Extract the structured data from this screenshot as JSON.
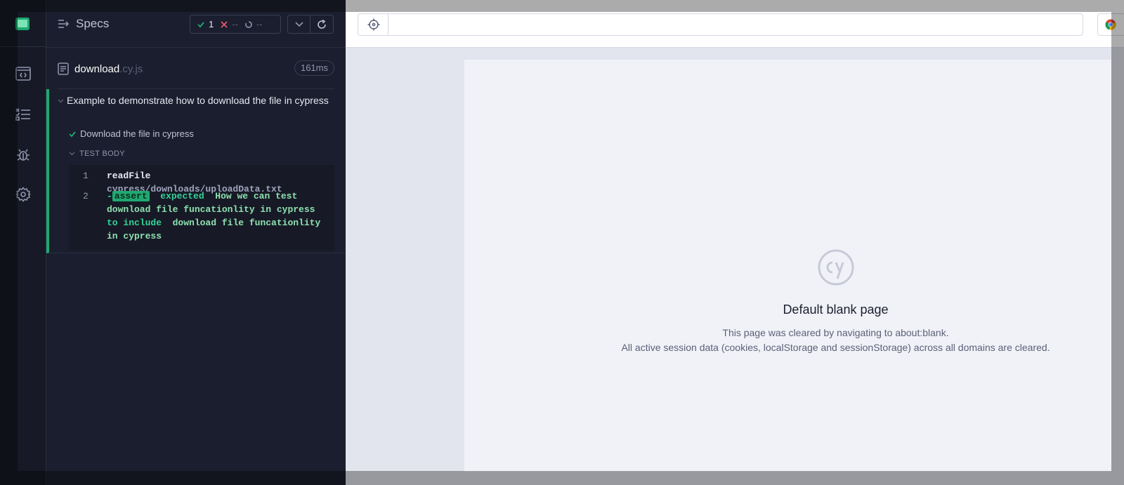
{
  "reporter": {
    "specs_label": "Specs",
    "stats": {
      "passed": "1",
      "failed": "--",
      "pending": "--"
    },
    "spec_file": {
      "name": "download",
      "ext": ".cy.js",
      "duration": "161ms"
    },
    "suite_title": "Example to demonstrate how to download the file in cypress",
    "test_title": "Download the file in cypress",
    "test_body_label": "TEST BODY",
    "commands": [
      {
        "num": "1",
        "name": "readFile",
        "arg": "cypress/downloads/uploadData.txt"
      },
      {
        "num": "2",
        "prefix": "-",
        "badge": "assert",
        "w1": "expected",
        "w2": "How we can test download file funcationlity in cypress",
        "w3": "to include",
        "w4": "download file funcationlity in cypress"
      }
    ]
  },
  "aut": {
    "url": "",
    "blank_title": "Default blank page",
    "blank_msg1": "This page was cleared by navigating to about:blank.",
    "blank_msg2": "All active session data (cookies, localStorage and sessionStorage) across all domains are cleared."
  },
  "icons": [
    "cypress-app-logo-icon",
    "specs-list-icon",
    "runs-icon",
    "debug-icon",
    "settings-icon",
    "selector-playground-icon",
    "chrome-icon",
    "cypress-cy-logo-icon"
  ],
  "colors": {
    "pass": "#1fa971",
    "fail": "#e45770",
    "sidebar_bg": "#1b1e2e",
    "aut_bg": "#f1f2f8"
  }
}
